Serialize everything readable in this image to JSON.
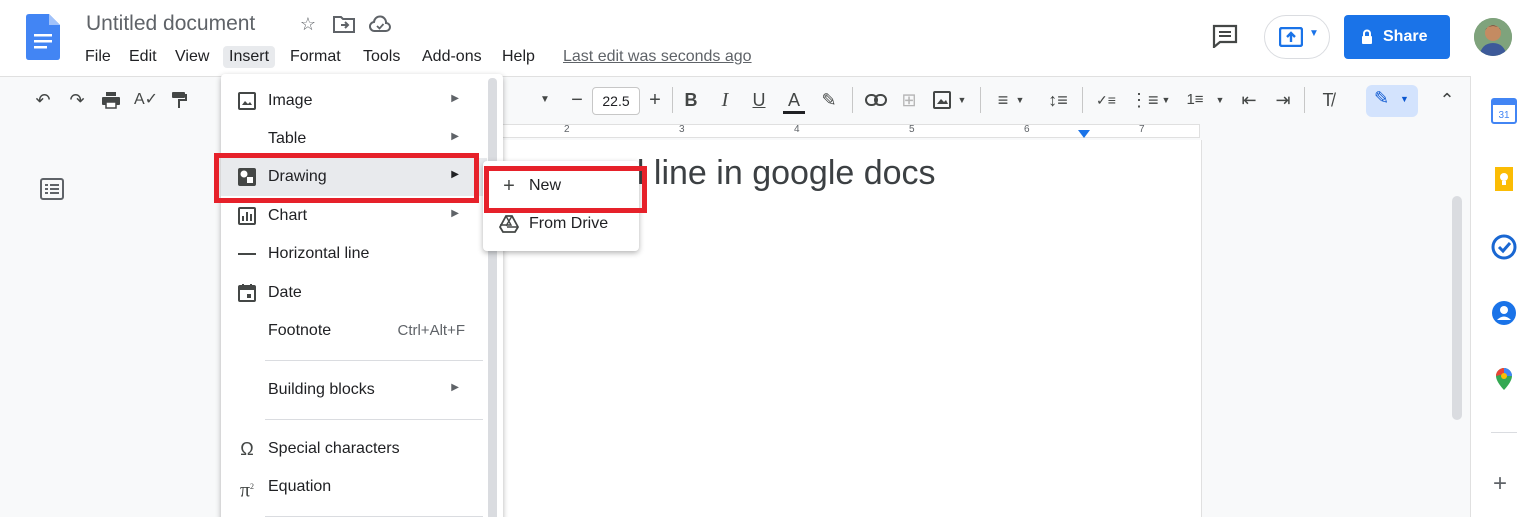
{
  "header": {
    "doc_title": "Untitled document",
    "menus": [
      "File",
      "Edit",
      "View",
      "Insert",
      "Format",
      "Tools",
      "Add-ons",
      "Help"
    ],
    "last_edit": "Last edit was seconds ago",
    "share_label": "Share"
  },
  "toolbar": {
    "font_size": "22.5"
  },
  "ruler": {
    "numbers": [
      "2",
      "3",
      "4",
      "5",
      "6",
      "7"
    ]
  },
  "document": {
    "visible_text": "al line in google docs"
  },
  "insert_menu": {
    "items": [
      {
        "label": "Image",
        "icon": "image-icon",
        "has_submenu": true
      },
      {
        "label": "Table",
        "icon": "",
        "has_submenu": true
      },
      {
        "label": "Drawing",
        "icon": "drawing-icon",
        "has_submenu": true
      },
      {
        "label": "Chart",
        "icon": "chart-icon",
        "has_submenu": true
      },
      {
        "label": "Horizontal line",
        "icon": "horizontal-line-icon",
        "has_submenu": false
      },
      {
        "label": "Date",
        "icon": "calendar-icon",
        "has_submenu": false
      },
      {
        "label": "Footnote",
        "icon": "",
        "has_submenu": false,
        "shortcut": "Ctrl+Alt+F"
      },
      {
        "label": "Building blocks",
        "icon": "",
        "has_submenu": true
      },
      {
        "label": "Special characters",
        "icon": "omega-icon",
        "has_submenu": false
      },
      {
        "label": "Equation",
        "icon": "pi-icon",
        "has_submenu": false
      }
    ]
  },
  "drawing_submenu": {
    "items": [
      {
        "label": "New",
        "icon": "plus-icon"
      },
      {
        "label": "From Drive",
        "icon": "drive-icon"
      }
    ]
  },
  "colors": {
    "accent": "#1a73e8",
    "highlight": "#e6212a",
    "docs_blue": "#4285f4"
  }
}
